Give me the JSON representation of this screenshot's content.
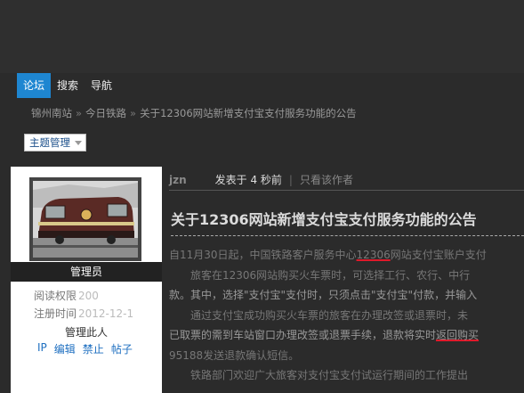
{
  "nav": {
    "items": [
      "论坛",
      "搜索",
      "导航"
    ]
  },
  "breadcrumb": [
    "锦州南站",
    "今日铁路",
    "关于12306网站新增支付宝支付服务功能的公告"
  ],
  "breadcrumb_sep": "»",
  "topic_manage": {
    "label": "主题管理"
  },
  "profile": {
    "role": "管理员",
    "read_perm_label": "阅读权限",
    "read_perm_value": "200",
    "reg_time_label": "注册时间",
    "reg_time_value": "2012-12-1",
    "manage_title": "管理此人",
    "manage_links": [
      "IP",
      "编辑",
      "禁止",
      "帖子"
    ]
  },
  "post": {
    "author": "jzn",
    "posted_at": "发表于 4 秒前",
    "pipe": "|",
    "only_author": "只看该作者",
    "title": "关于12306网站新增支付宝支付服务功能的公告",
    "body": {
      "l1a": "自11月30日起，中国铁路客户服务中心",
      "l1b": "12306",
      "l1c": "网站支付宝账户支付",
      "l2": "　　旅客在12306网站购买火车票时，可选择工行、农行、中行",
      "l3": "款。其中，选择\"支付宝\"支付时，只须点击\"支付宝\"付款，并输入",
      "l4": "　　通过支付宝成功购买火车票的旅客在办理改签或退票时，未",
      "l5a": "已取票的需到车站窗口办理改签或退票手续，退款将实时",
      "l5b": "返回购买",
      "l6": "95188发送退款确认短信。",
      "l7": "　　铁路部门欢迎广大旅客对支付宝支付试运行期间的工作提出"
    }
  }
}
